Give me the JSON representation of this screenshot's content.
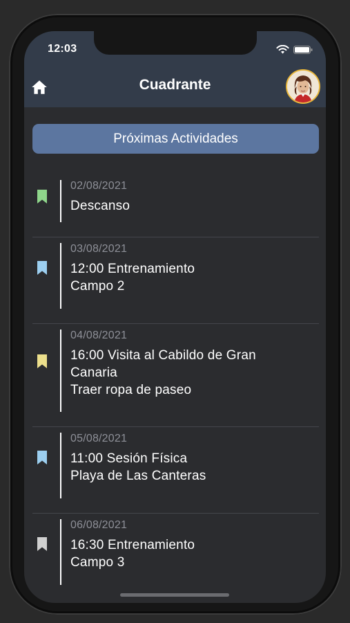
{
  "status_bar": {
    "time": "12:03"
  },
  "header": {
    "title": "Cuadrante"
  },
  "section": {
    "title": "Próximas Actividades"
  },
  "colors": {
    "header_bg": "#333c4a",
    "section_bg": "#5c76a0",
    "background": "#2b2c2f",
    "green": "#8fd68b",
    "blue": "#9ccff0",
    "yellow": "#ecdf8c",
    "gray": "#d0d0d0"
  },
  "activities": [
    {
      "date": "02/08/2021",
      "lines": [
        "Descanso"
      ],
      "marker_icon": "bookmark-icon",
      "marker_color": "green"
    },
    {
      "date": "03/08/2021",
      "lines": [
        "12:00 Entrenamiento",
        "Campo 2"
      ],
      "marker_icon": "bookmark-icon",
      "marker_color": "blue"
    },
    {
      "date": "04/08/2021",
      "lines": [
        "16:00 Visita al Cabildo de Gran",
        "Canaria",
        "Traer ropa de paseo"
      ],
      "marker_icon": "bookmark-icon",
      "marker_color": "yellow"
    },
    {
      "date": "05/08/2021",
      "lines": [
        "11:00 Sesión Física",
        "Playa de Las Canteras"
      ],
      "marker_icon": "bookmark-icon",
      "marker_color": "blue"
    },
    {
      "date": "06/08/2021",
      "lines": [
        "16:30 Entrenamiento",
        "Campo 3"
      ],
      "marker_icon": "bookmark-icon",
      "marker_color": "gray"
    }
  ]
}
